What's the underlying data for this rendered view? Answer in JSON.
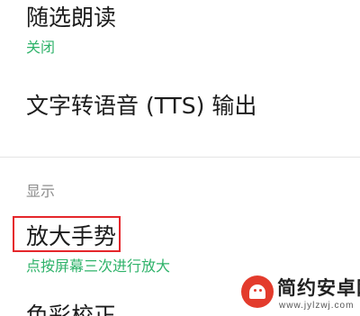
{
  "settings": {
    "select_to_speak": {
      "title": "随选朗读",
      "summary": "关闭"
    },
    "tts_output": {
      "title": "文字转语音 (TTS) 输出"
    },
    "display_section": {
      "header": "显示"
    },
    "magnification": {
      "title": "放大手势",
      "summary": "点按屏幕三次进行放大"
    },
    "color_correction": {
      "title": "色彩校正"
    }
  },
  "watermark": {
    "site_name": "简约安卓网",
    "url": "www.jylzwj.com",
    "icon": "android-logo-icon"
  },
  "colors": {
    "summary_green": "#2fb36a",
    "highlight_red": "#e5262b",
    "section_gray": "#8c8c8c"
  }
}
